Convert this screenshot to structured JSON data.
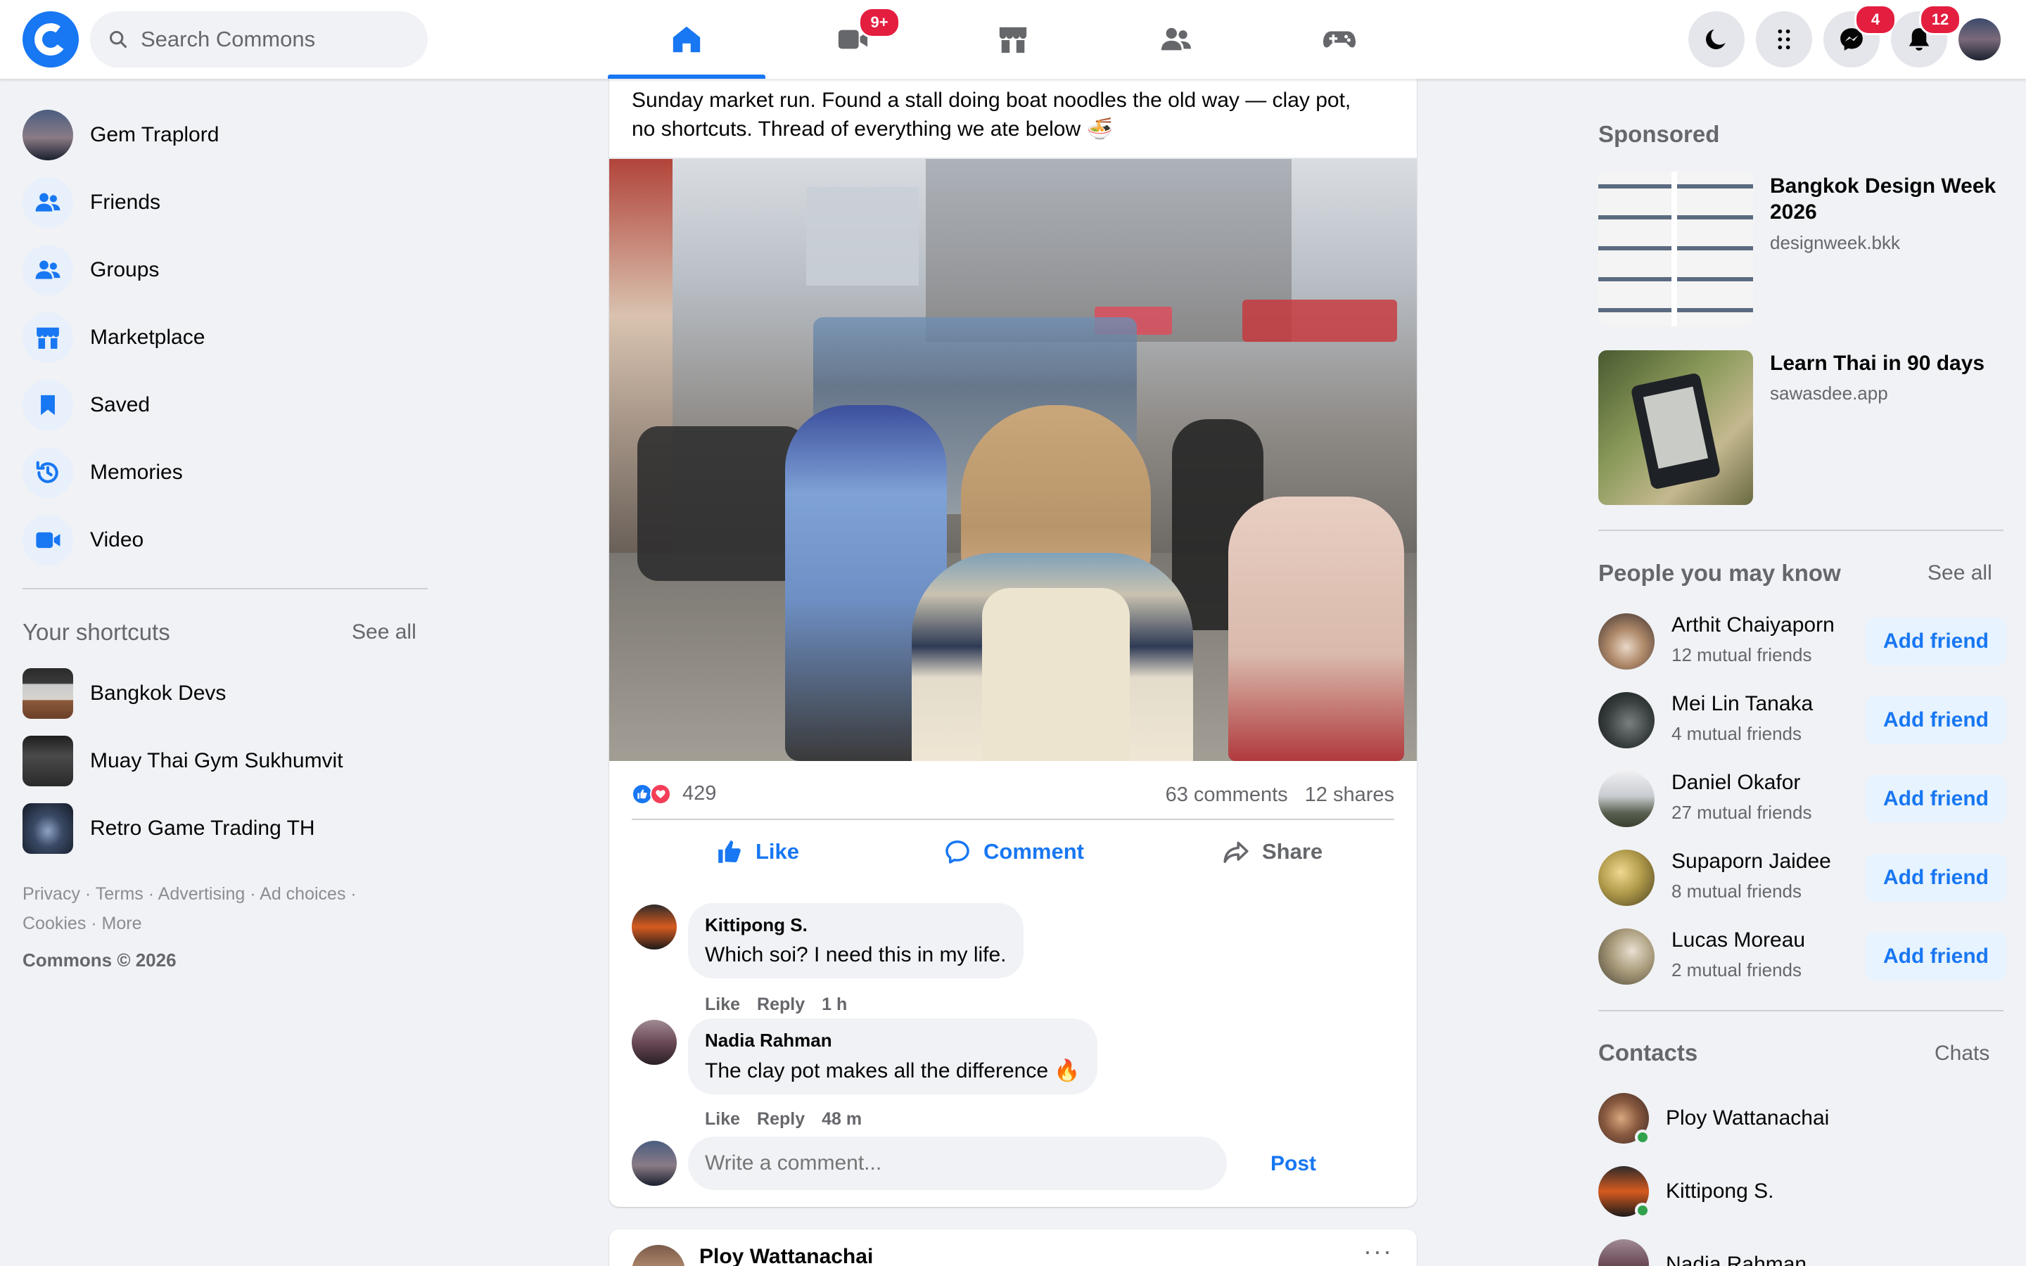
{
  "topbar": {
    "search_placeholder": "Search Commons",
    "video_badge": "9+",
    "messages_badge": "4",
    "notifications_badge": "12"
  },
  "sidebar": {
    "profile_name": "Gem Traplord",
    "items": [
      {
        "label": "Friends",
        "icon": "friends-icon"
      },
      {
        "label": "Groups",
        "icon": "groups-icon"
      },
      {
        "label": "Marketplace",
        "icon": "marketplace-icon"
      },
      {
        "label": "Saved",
        "icon": "bookmark-icon"
      },
      {
        "label": "Memories",
        "icon": "memories-icon"
      },
      {
        "label": "Video",
        "icon": "video-icon"
      }
    ],
    "shortcuts_title": "Your shortcuts",
    "shortcuts_see_all": "See all",
    "shortcuts": [
      {
        "label": "Bangkok Devs"
      },
      {
        "label": "Muay Thai Gym Sukhumvit"
      },
      {
        "label": "Retro Game Trading TH"
      }
    ],
    "footer": {
      "privacy": "Privacy",
      "terms": "Terms",
      "advertising": "Advertising",
      "ad_choices": "Ad choices",
      "cookies": "Cookies",
      "more": "More",
      "copyright": "Commons © 2026"
    }
  },
  "post": {
    "text_line1": "Sunday market run. Found a stall doing boat noodles the old way — clay pot,",
    "text_line2": "no shortcuts. Thread of everything we ate below 🍜",
    "reactions_count": "429",
    "comments_count": "63 comments",
    "shares_count": "12 shares",
    "like_label": "Like",
    "comment_label": "Comment",
    "share_label": "Share",
    "comments": [
      {
        "author": "Kittipong S.",
        "text": "Which soi? I need this in my life.",
        "like": "Like",
        "reply": "Reply",
        "time": "1 h"
      },
      {
        "author": "Nadia Rahman",
        "text": "The clay pot makes all the difference 🔥",
        "like": "Like",
        "reply": "Reply",
        "time": "48 m"
      }
    ],
    "comment_placeholder": "Write a comment...",
    "post_button": "Post"
  },
  "next_post": {
    "author": "Ploy Wattanachai"
  },
  "right": {
    "sponsored_title": "Sponsored",
    "ads": [
      {
        "title_line1": "Bangkok Design Week",
        "title_line2": "2026",
        "domain": "designweek.bkk"
      },
      {
        "title_line1": "Learn Thai in 90 days",
        "title_line2": "",
        "domain": "sawasdee.app"
      }
    ],
    "pymk_title": "People you may know",
    "pymk_see_all": "See all",
    "people": [
      {
        "name": "Arthit Chaiyaporn",
        "mutual": "12 mutual friends",
        "button": "Add friend"
      },
      {
        "name": "Mei Lin Tanaka",
        "mutual": "4 mutual friends",
        "button": "Add friend"
      },
      {
        "name": "Daniel Okafor",
        "mutual": "27 mutual friends",
        "button": "Add friend"
      },
      {
        "name": "Supaporn Jaidee",
        "mutual": "8 mutual friends",
        "button": "Add friend"
      },
      {
        "name": "Lucas Moreau",
        "mutual": "2 mutual friends",
        "button": "Add friend"
      }
    ],
    "contacts_title": "Contacts",
    "contacts_link": "Chats",
    "contacts": [
      {
        "name": "Ploy Wattanachai"
      },
      {
        "name": "Kittipong S."
      },
      {
        "name": "Nadia Rahman"
      }
    ]
  },
  "colors": {
    "brand": "#1877f2",
    "badge": "#e41e3f",
    "online": "#31a24c"
  }
}
